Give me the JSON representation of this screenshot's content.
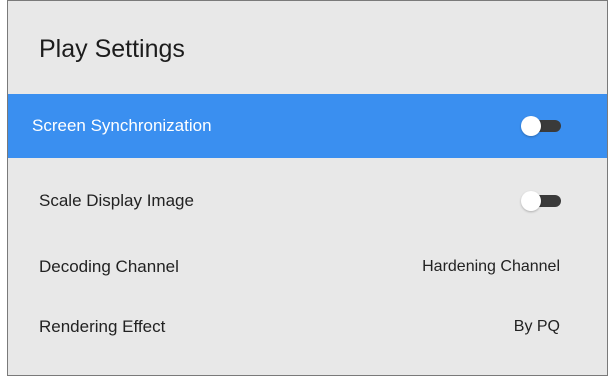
{
  "header": {
    "title": "Play Settings"
  },
  "settings": [
    {
      "label": "Screen Synchronization",
      "control": "toggle",
      "on": false,
      "selected": true
    },
    {
      "label": "Scale Display Image",
      "control": "toggle",
      "on": false,
      "selected": false
    },
    {
      "label": "Decoding Channel",
      "control": "value",
      "value": "Hardening Channel",
      "selected": false
    },
    {
      "label": "Rendering Effect",
      "control": "value",
      "value": "By PQ",
      "selected": false
    }
  ],
  "colors": {
    "selected_row": "#3a8ff0",
    "panel_background": "#e8e8e8",
    "toggle_track": "#3a3a3a",
    "toggle_thumb": "#ffffff"
  }
}
